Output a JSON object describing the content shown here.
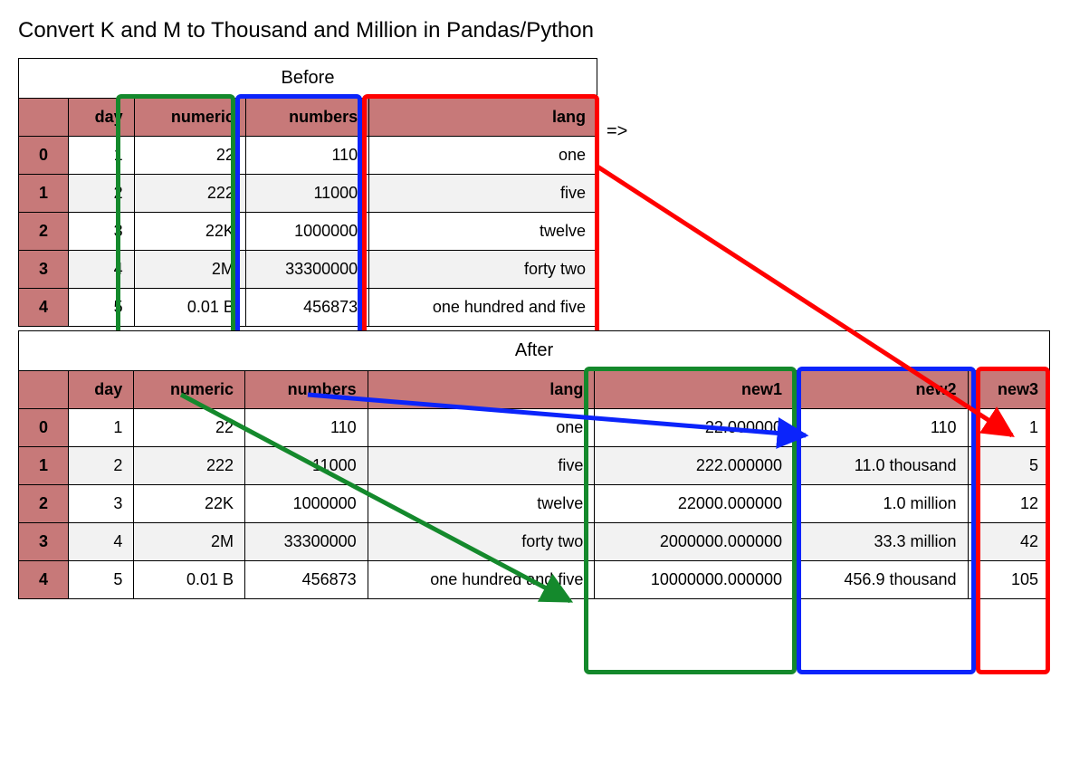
{
  "title": "Convert K and M to Thousand and Million in Pandas/Python",
  "arrow_label": "=>",
  "before": {
    "caption": "Before",
    "headers": [
      "day",
      "numeric",
      "numbers",
      "lang"
    ],
    "index": [
      "0",
      "1",
      "2",
      "3",
      "4"
    ],
    "rows": [
      [
        "1",
        "22",
        "110",
        "one"
      ],
      [
        "2",
        "222",
        "11000",
        "five"
      ],
      [
        "3",
        "22K",
        "1000000",
        "twelve"
      ],
      [
        "4",
        "2M",
        "33300000",
        "forty two"
      ],
      [
        "5",
        "0.01 B",
        "456873",
        "one hundred and five"
      ]
    ]
  },
  "after": {
    "caption": "After",
    "headers": [
      "day",
      "numeric",
      "numbers",
      "lang",
      "new1",
      "new2",
      "new3"
    ],
    "index": [
      "0",
      "1",
      "2",
      "3",
      "4"
    ],
    "rows": [
      [
        "1",
        "22",
        "110",
        "one",
        "22.000000",
        "110",
        "1"
      ],
      [
        "2",
        "222",
        "11000",
        "five",
        "222.000000",
        "11.0 thousand",
        "5"
      ],
      [
        "3",
        "22K",
        "1000000",
        "twelve",
        "22000.000000",
        "1.0 million",
        "12"
      ],
      [
        "4",
        "2M",
        "33300000",
        "forty two",
        "2000000.000000",
        "33.3 million",
        "42"
      ],
      [
        "5",
        "0.01 B",
        "456873",
        "one hundred and five",
        "10000000.000000",
        "456.9 thousand",
        "105"
      ]
    ]
  },
  "colors": {
    "green": "#14892c",
    "blue": "#0b24fb",
    "red": "#ff0000"
  }
}
